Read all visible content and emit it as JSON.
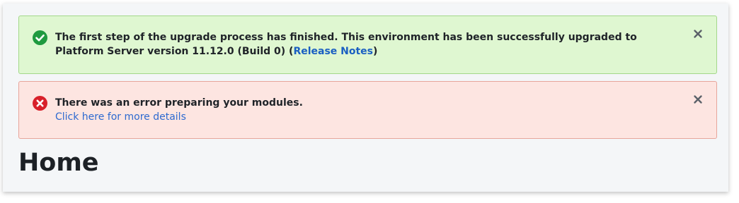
{
  "alerts": {
    "success": {
      "message_before": "The first step of the upgrade process has finished. This environment has been successfully upgraded to Platform Server version 11.12.0 (Build 0) (",
      "link_label": "Release Notes",
      "message_after": ")",
      "icon": "check-circle-icon",
      "close_icon": "close-icon",
      "color": "#1f9a3f"
    },
    "error": {
      "message": "There was an error preparing your modules.",
      "link_label": "Click here for more details",
      "icon": "error-circle-icon",
      "close_icon": "close-icon",
      "color": "#d8202a"
    }
  },
  "page": {
    "title": "Home"
  }
}
